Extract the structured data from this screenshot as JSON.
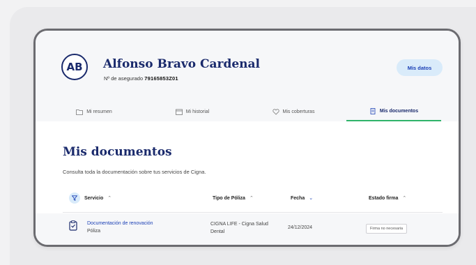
{
  "profile": {
    "initials": "AB",
    "name": "Alfonso Bravo Cardenal",
    "policy_label": "Nº de asegurado",
    "policy_number": "79165853Z01",
    "mis_datos_label": "Mis datos"
  },
  "tabs": [
    {
      "label": "Mi resumen",
      "icon": "folder-icon",
      "active": false
    },
    {
      "label": "Mi historial",
      "icon": "calendar-icon",
      "active": false
    },
    {
      "label": "Mis coberturas",
      "icon": "heart-icon",
      "active": false
    },
    {
      "label": "Mis documentos",
      "icon": "document-icon",
      "active": true
    }
  ],
  "content": {
    "title": "Mis documentos",
    "subtitle": "Consulta toda la documentación sobre tus servicios de Cigna."
  },
  "table": {
    "headers": {
      "servicio": "Servicio",
      "tipo": "Tipo de Póliza",
      "fecha": "Fecha",
      "estado": "Estado firma"
    },
    "rows": [
      {
        "servicio": "Documentación de renovación",
        "servicio_sub": "Póliza",
        "tipo_line1": "CIGNA LIFE - Cigna Salud",
        "tipo_line2": "Dental",
        "fecha": "24/12/2024",
        "estado": "Firma no necesaria"
      }
    ]
  },
  "colors": {
    "brand_navy": "#1a2a6c",
    "link_blue": "#1a3fb5",
    "active_tab_underline": "#2fb46a",
    "pill_background": "#d9ebfa"
  }
}
